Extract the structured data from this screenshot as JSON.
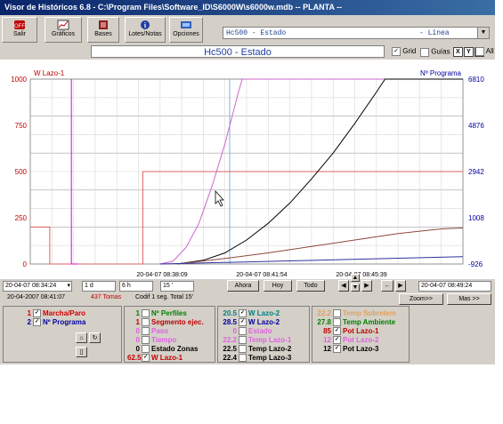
{
  "window": {
    "title": "Visor de Históricos 6.8 - C:\\Program Files\\Software_ID\\S6000W\\s6000w.mdb  --  PLANTA  --"
  },
  "toolbar": {
    "salir": "Salir",
    "graficos": "Gráficos",
    "bases": "Bases",
    "lotes": "Lotes/Notas",
    "opciones": "Opciones"
  },
  "selector": {
    "value": "Hc500 - Estado",
    "mode": "- Línea"
  },
  "chart_title": "Hc500 - Estado",
  "toggles": {
    "grid": "Grid",
    "guias": "Guías",
    "x": "X",
    "y": "Y",
    "e": "E",
    "all": "All"
  },
  "chart_data": {
    "type": "line",
    "left_axis_title": "W Lazo-1",
    "right_axis_title": "Nº Programa",
    "left_ticks": [
      "1000",
      "750",
      "500",
      "250",
      "0"
    ],
    "right_ticks": [
      "6810",
      "4876",
      "2942",
      "1008",
      "-926"
    ],
    "ylim_left": [
      0,
      1000
    ],
    "x_ticks": [
      "20-04-07 08:38:09",
      "20-04-07 08:41:54",
      "20-04-07 08:45:39"
    ],
    "grid": true,
    "series": [
      {
        "color": "#e06060",
        "points": [
          [
            0,
            200
          ],
          [
            0.045,
            200
          ],
          [
            0.045,
            0
          ],
          [
            0.26,
            0
          ],
          [
            0.26,
            500
          ],
          [
            1,
            500
          ]
        ]
      },
      {
        "color": "#e000e0",
        "points": [
          [
            0.095,
            1000
          ],
          [
            0.095,
            0
          ],
          [
            0.11,
            0
          ]
        ]
      },
      {
        "color": "#cc66cc",
        "points": [
          [
            0.3,
            0
          ],
          [
            0.33,
            15
          ],
          [
            0.36,
            90
          ],
          [
            0.39,
            220
          ],
          [
            0.42,
            420
          ],
          [
            0.45,
            650
          ],
          [
            0.48,
            920
          ],
          [
            0.49,
            1000
          ],
          [
            1,
            1000
          ]
        ]
      },
      {
        "color": "#000000",
        "points": [
          [
            0.34,
            0
          ],
          [
            0.4,
            20
          ],
          [
            0.45,
            60
          ],
          [
            0.5,
            130
          ],
          [
            0.55,
            220
          ],
          [
            0.6,
            330
          ],
          [
            0.65,
            460
          ],
          [
            0.7,
            600
          ],
          [
            0.75,
            760
          ],
          [
            0.8,
            930
          ],
          [
            0.82,
            1000
          ],
          [
            1,
            1000
          ]
        ]
      },
      {
        "color": "#8a4a3a",
        "points": [
          [
            0.34,
            0
          ],
          [
            0.45,
            30
          ],
          [
            0.55,
            60
          ],
          [
            0.65,
            95
          ],
          [
            0.75,
            130
          ],
          [
            0.85,
            165
          ],
          [
            0.95,
            190
          ],
          [
            1,
            195
          ]
        ]
      },
      {
        "color": "#3030a0",
        "points": [
          [
            0.3,
            0
          ],
          [
            1,
            40
          ]
        ]
      }
    ]
  },
  "nav": {
    "start": "20-04-07 08:34:24",
    "d": "1 d",
    "h": "6 h",
    "m": "15 '",
    "ahora": "Ahora",
    "hoy": "Hoy",
    "todo": "Todo",
    "end": "20-04-07 08:49:24",
    "zoom": "Zoom>>",
    "mas": "Mas >>"
  },
  "info": {
    "datetime": "20-04-2007 08:41:07",
    "tomas": "437 Tomas",
    "codif": "Codif 1 seg. Total 15'"
  },
  "legend": {
    "g1": [
      {
        "num": "1",
        "label": "Marcha/Paro",
        "color": "#d00000",
        "checked": true
      },
      {
        "num": "2",
        "label": "Nº Programa",
        "color": "#0000a0",
        "checked": true
      }
    ],
    "g2": [
      {
        "num": "1",
        "label": "Nº Perfiles",
        "color": "#008000",
        "checked": false
      },
      {
        "num": "1",
        "label": "Segmento ejec.",
        "color": "#c00000",
        "checked": false
      },
      {
        "num": "0",
        "label": "Paso",
        "color": "#e060e0",
        "checked": false
      },
      {
        "num": "0",
        "label": "Tiempo",
        "color": "#e060e0",
        "checked": false
      },
      {
        "num": "0",
        "label": "Estado Zonas",
        "color": "#000000",
        "checked": false
      },
      {
        "num": "62.5",
        "label": "W Lazo-1",
        "color": "#c00000",
        "checked": true
      }
    ],
    "g3": [
      {
        "num": "20.5",
        "label": "W Lazo-2",
        "color": "#008080",
        "checked": true
      },
      {
        "num": "28.5",
        "label": "W Lazo-2",
        "color": "#0000a0",
        "checked": true
      },
      {
        "num": "0",
        "label": "Estado",
        "color": "#e060e0",
        "checked": false
      },
      {
        "num": "22.2",
        "label": "Temp Lazo-1",
        "color": "#e060e0",
        "checked": false
      },
      {
        "num": "22.5",
        "label": "Temp Lazo-2",
        "color": "#000000",
        "checked": false
      },
      {
        "num": "22.4",
        "label": "Temp Lazo-3",
        "color": "#000000",
        "checked": false
      }
    ],
    "g4": [
      {
        "num": "22.2",
        "label": "Temp Sobretem",
        "color": "#e0a060",
        "checked": false
      },
      {
        "num": "27.8",
        "label": "Temp Ambiente",
        "color": "#008000",
        "checked": false
      },
      {
        "num": "85",
        "label": "Pot Lazo-1",
        "color": "#c00000",
        "checked": true
      },
      {
        "num": "12",
        "label": "Pot Lazo-2",
        "color": "#e060e0",
        "checked": true
      },
      {
        "num": "12",
        "label": "Pot Lazo-3",
        "color": "#000000",
        "checked": true
      }
    ]
  }
}
